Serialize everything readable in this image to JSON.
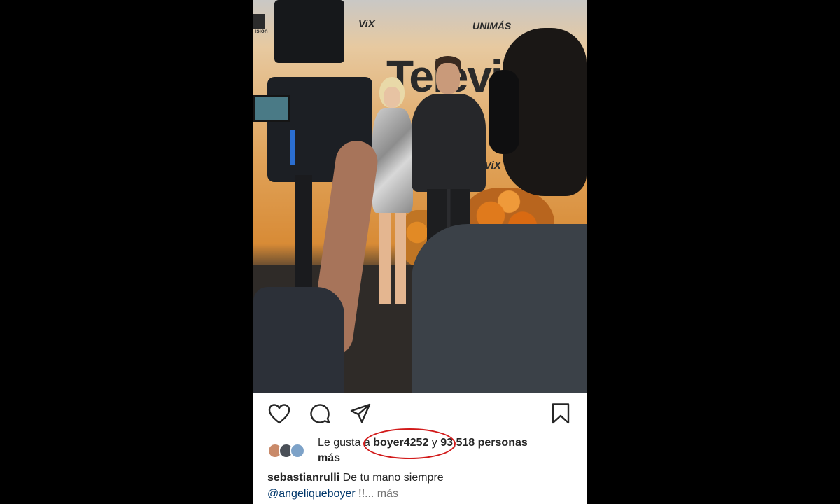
{
  "photo": {
    "backdrop_logos": [
      "ViX",
      "UNIMÁS"
    ],
    "backdrop_partial_text": [
      "Televis",
      "ViX"
    ],
    "backdrop_edge_text": "ision"
  },
  "actions": {
    "like": "heart-icon",
    "comment": "comment-icon",
    "share": "share-icon",
    "save": "bookmark-icon"
  },
  "likes": {
    "prefix": "Le gusta a ",
    "user": "boyer4252",
    "conj": " y ",
    "count": "93,518 personas",
    "suffix": "más"
  },
  "caption": {
    "username": "sebastianrulli",
    "text": " De tu mano siempre",
    "mention": "@angeliqueboyer",
    "tail": " !!",
    "more": "... más"
  },
  "colors": {
    "highlight": "#d21a1a",
    "mention": "#00376b",
    "text": "#262626"
  }
}
